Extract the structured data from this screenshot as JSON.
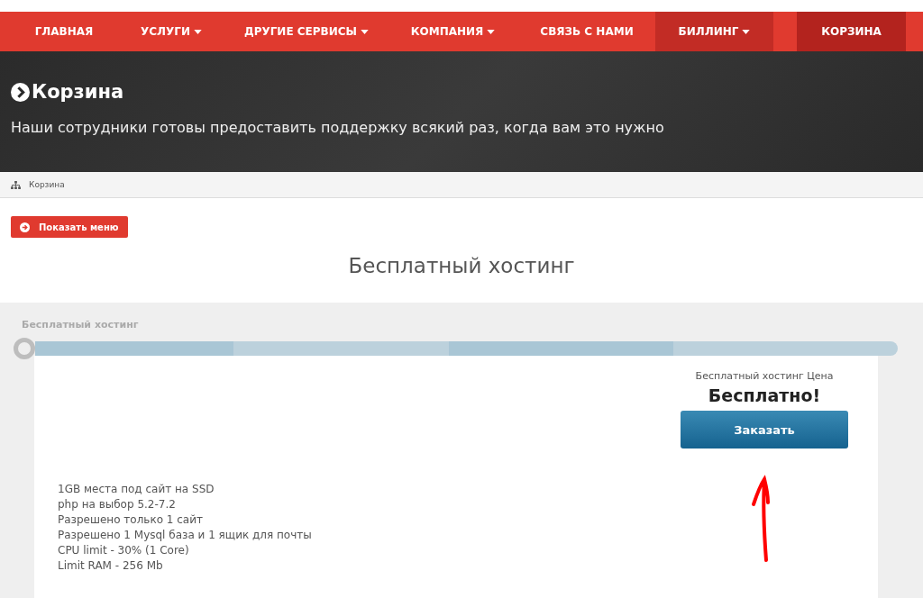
{
  "nav": {
    "items": [
      {
        "label": "ГЛАВНАЯ",
        "has_caret": false,
        "highlighted": false,
        "selected": false
      },
      {
        "label": "УСЛУГИ",
        "has_caret": true,
        "highlighted": false,
        "selected": false
      },
      {
        "label": "ДРУГИЕ СЕРВИСЫ",
        "has_caret": true,
        "highlighted": false,
        "selected": false
      },
      {
        "label": "КОМПАНИЯ",
        "has_caret": true,
        "highlighted": false,
        "selected": false
      },
      {
        "label": "СВЯЗЬ С НАМИ",
        "has_caret": false,
        "highlighted": false,
        "selected": false
      },
      {
        "label": "БИЛЛИНГ",
        "has_caret": true,
        "highlighted": true,
        "selected": false
      },
      {
        "label": "КОРЗИНА",
        "has_caret": false,
        "highlighted": false,
        "selected": true
      }
    ]
  },
  "hero": {
    "title": "Корзина",
    "subtitle": "Наши сотрудники готовы предоставить поддержку всякий раз, когда вам это нужно"
  },
  "breadcrumb": [
    "Корзина"
  ],
  "menu_button": "Показать меню",
  "heading": "Бесплатный хостинг",
  "progress": {
    "label": "Бесплатный хостинг",
    "level": 0
  },
  "product": {
    "price_label": "Бесплатный хостинг Цена",
    "price": "Бесплатно!",
    "order_button": "Заказать",
    "features": [
      "1GB места под сайт на SSD",
      "php на выбор 5.2-7.2",
      "Разрешено только 1 сайт",
      "Разрешено 1 Mysql база и 1 ящик для почты",
      "CPU limit - 30% (1 Core)",
      "Limit RAM - 256 Mb"
    ]
  }
}
